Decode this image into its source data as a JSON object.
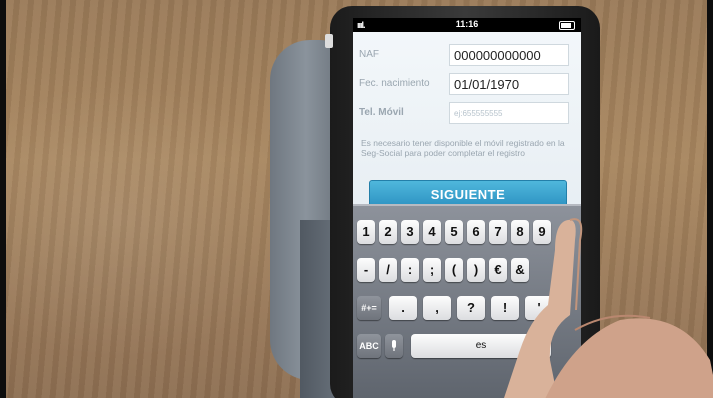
{
  "status": {
    "time": "11:16",
    "signal": "ıııl."
  },
  "form": {
    "naf_label": "NAF",
    "naf_value": "000000000000",
    "fecha_label": "Fec. nacimiento",
    "fecha_value": "01/01/1970",
    "tel_label": "Tel. Móvil",
    "tel_placeholder": "ej:655555555",
    "note": "Es necesario tener disponible el móvil registrado en la Seg-Social para poder completar el registro",
    "next_label": "SIGUIENTE"
  },
  "keyboard": {
    "row1": [
      "1",
      "2",
      "3",
      "4",
      "5",
      "6",
      "7",
      "8",
      "9"
    ],
    "row2": [
      "-",
      "/",
      ":",
      ";",
      "(",
      ")",
      "€",
      "&"
    ],
    "row3_toggle": "#+=",
    "row3": [
      ".",
      ",",
      "?",
      "!",
      "'"
    ],
    "abc": "ABC",
    "mic": "mic-icon",
    "space": "es"
  }
}
